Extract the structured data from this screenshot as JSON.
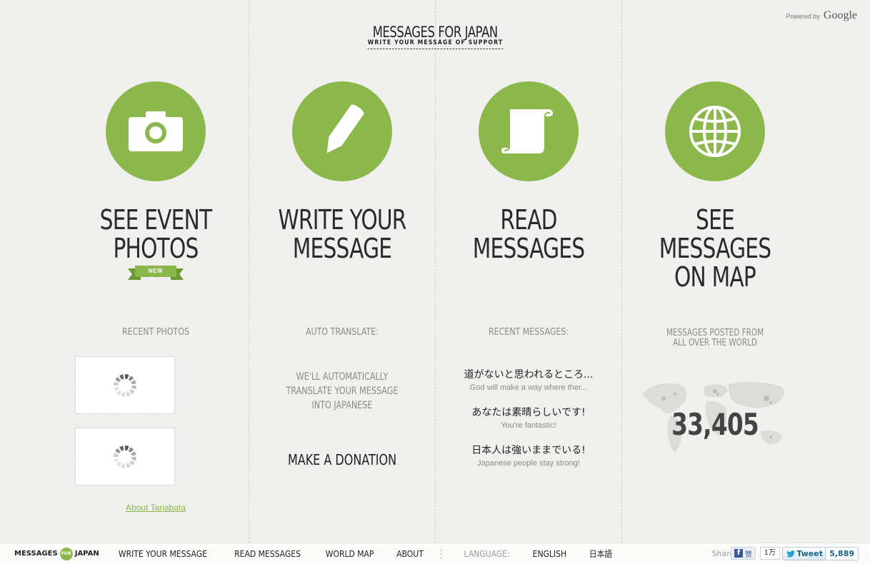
{
  "header": {
    "powered_by": "Powered by",
    "google": "Google",
    "title": "MESSAGES FOR JAPAN",
    "subtitle": "WRITE YOUR MESSAGE OF SUPPORT"
  },
  "columns": {
    "photos": {
      "heading_line1": "SEE EVENT",
      "heading_line2": "PHOTOS",
      "badge": "NEW",
      "subhead": "RECENT PHOTOS",
      "about_link": "About Tanabata"
    },
    "write": {
      "heading_line1": "WRITE YOUR",
      "heading_line2": "MESSAGE",
      "subhead": "AUTO TRANSLATE:",
      "translate_line1": "WE'LL AUTOMATICALLY",
      "translate_line2": "TRANSLATE YOUR MESSAGE",
      "translate_line3": "INTO JAPANESE",
      "donation": "MAKE A DONATION"
    },
    "read": {
      "heading_line1": "READ",
      "heading_line2": "MESSAGES",
      "subhead": "RECENT MESSAGES:",
      "messages": [
        {
          "jp": "道がないと思われるところ...",
          "en": "God will make a way where ther..."
        },
        {
          "jp": "あなたは素晴らしいです!",
          "en": "You're fantastic!"
        },
        {
          "jp": "日本人は強いままでいる!",
          "en": "Japanese people stay strong!"
        }
      ]
    },
    "map": {
      "heading_line1": "SEE MESSAGES",
      "heading_line2": "ON MAP",
      "subhead_line1": "MESSAGES POSTED FROM",
      "subhead_line2": "ALL OVER THE WORLD",
      "count": "33,405"
    }
  },
  "footer": {
    "logo_left": "MESSAGES",
    "logo_for": "FOR",
    "logo_right": "JAPAN",
    "nav": [
      "WRITE YOUR MESSAGE",
      "READ MESSAGES",
      "WORLD MAP",
      "ABOUT"
    ],
    "language_label": "LANGUAGE:",
    "languages": [
      "ENGLISH",
      "日本語"
    ],
    "share_label": "Share:",
    "fb_label": "赞",
    "fb_count": "1万",
    "tweet_label": "Tweet",
    "tweet_count": "5,889"
  },
  "colors": {
    "accent_green": "#8bb74b",
    "background": "#f1f1ef"
  }
}
